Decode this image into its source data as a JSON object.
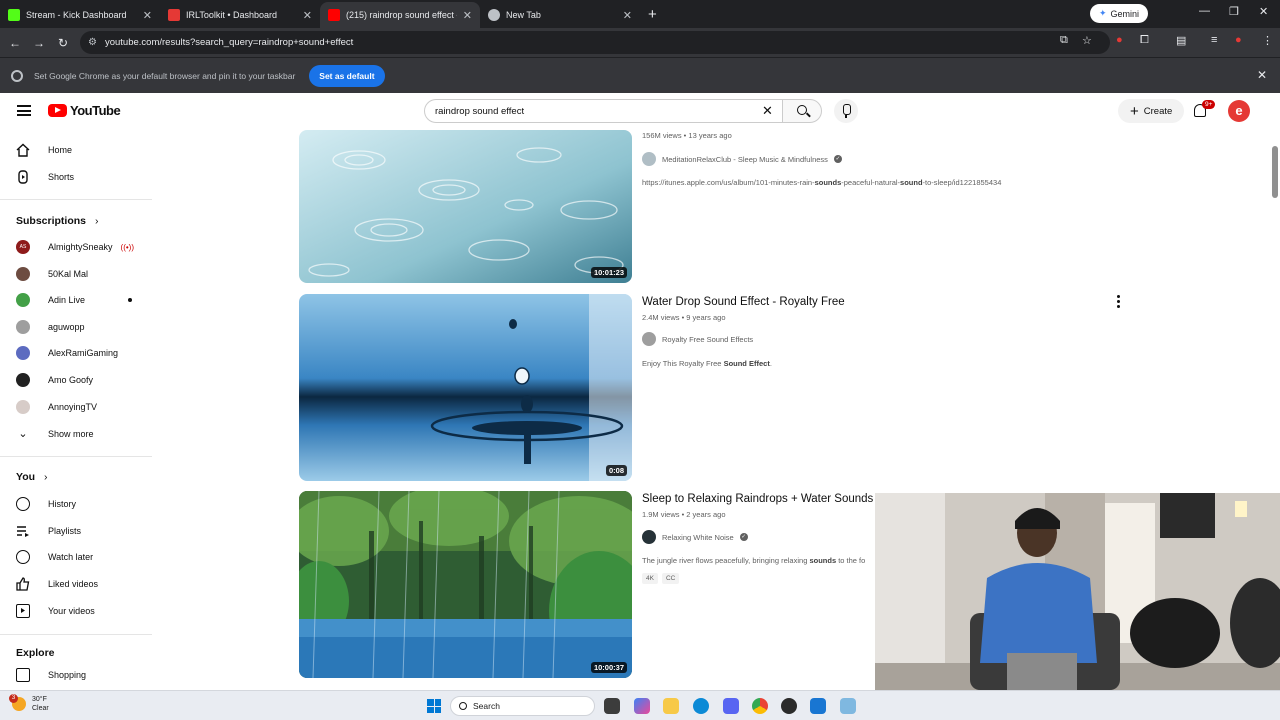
{
  "browser": {
    "tabs": [
      {
        "label": "Stream - Kick Dashboard",
        "color": "#53fc18"
      },
      {
        "label": "IRLToolkit • Dashboard",
        "color": "#e53935"
      },
      {
        "label": "(215) raindrop sound effect - Y",
        "color": "#ff0000"
      },
      {
        "label": "New Tab",
        "color": "#bdc1c6"
      }
    ],
    "gemini_label": "Gemini",
    "url": "youtube.com/results?search_query=raindrop+sound+effect",
    "infobar_message": "Set Google Chrome as your default browser and pin it to your taskbar",
    "infobar_button": "Set as default"
  },
  "youtube": {
    "logo_text": "YouTube",
    "search_value": "raindrop sound effect",
    "create_label": "Create",
    "notification_badge": "9+",
    "avatar_letter": "e"
  },
  "sidebar": {
    "home": "Home",
    "shorts": "Shorts",
    "subscriptions_header": "Subscriptions",
    "subscriptions": [
      {
        "name": "AlmightySneaky",
        "live": true,
        "color": "#8e1b1b",
        "initials": "AS"
      },
      {
        "name": "50Kal Mal",
        "color": "#6d4c41"
      },
      {
        "name": "Adin Live",
        "dot": true,
        "color": "#43a047"
      },
      {
        "name": "aguwopp",
        "color": "#9e9e9e"
      },
      {
        "name": "AlexRamiGaming",
        "color": "#5c6bc0"
      },
      {
        "name": "Amo Goofy",
        "color": "#212121"
      },
      {
        "name": "AnnoyingTV",
        "color": "#d7ccc8"
      }
    ],
    "show_more": "Show more",
    "you_header": "You",
    "you_items": [
      "History",
      "Playlists",
      "Watch later",
      "Liked videos",
      "Your videos"
    ],
    "explore_header": "Explore",
    "explore_items": [
      "Shopping"
    ]
  },
  "results": [
    {
      "title": "",
      "meta": "156M views • 13 years ago",
      "channel": "MeditationRelaxClub - Sleep Music & Mindfulness",
      "verified": true,
      "desc_pre": "https://itunes.apple.com/us/album/101-minutes-rain-",
      "desc_b1": "sounds",
      "desc_mid": "-peaceful-natural-",
      "desc_b2": "sound",
      "desc_post": "-to-sleep/id1221855434",
      "duration": "10:01:23"
    },
    {
      "title": "Water Drop Sound Effect - Royalty Free",
      "meta": "2.4M views • 9 years ago",
      "channel": "Royalty Free Sound Effects",
      "verified": false,
      "desc_pre": "Enjoy This Royalty Free ",
      "desc_b1": "Sound Effect",
      "desc_post": ".",
      "duration": "0:08"
    },
    {
      "title": "Sleep to Relaxing Raindrops + Water Sounds",
      "meta": "1.9M views • 2 years ago",
      "channel": "Relaxing White Noise",
      "verified": true,
      "desc_pre": "The jungle river flows peacefully, bringing relaxing ",
      "desc_b1": "sounds",
      "desc_post": " to the fo",
      "chips": [
        "4K",
        "CC"
      ],
      "duration": "10:00:37"
    }
  ],
  "taskbar": {
    "weather_temp": "30°F",
    "weather_cond": "Clear",
    "weather_badge": "3",
    "search_placeholder": "Search"
  }
}
